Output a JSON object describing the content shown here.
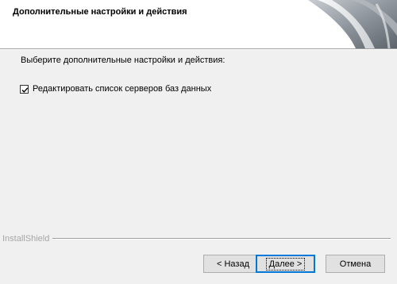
{
  "header": {
    "title": "Дополнительные настройки и действия",
    "graphic": "installshield-swoosh-image"
  },
  "content": {
    "instruction": "Выберите дополнительные настройки и действия:",
    "checkbox": {
      "label": "Редактировать список серверов баз данных",
      "checked": true
    }
  },
  "footer": {
    "brand": "InstallShield",
    "back_label": "< Назад",
    "next_label": "Далее >",
    "cancel_label": "Отмена"
  }
}
